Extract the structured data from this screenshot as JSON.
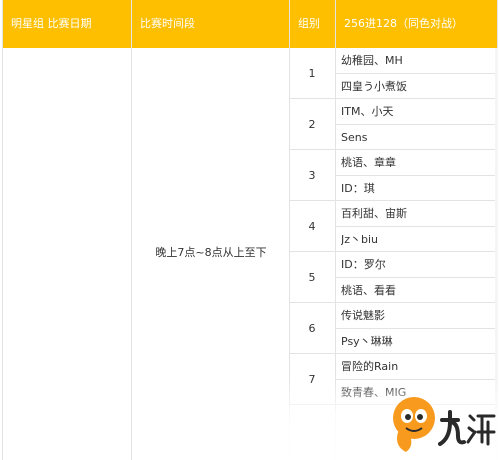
{
  "header": {
    "col1": "明星组 比赛日期",
    "col2": "比赛时间段",
    "col3": "组别",
    "col4": "256进128（同色对战）"
  },
  "time_slot": "晚上7点~8点从上至下",
  "groups": [
    {
      "number": "1",
      "teams": [
        "幼稚园、MH",
        "四皇う小煮饭"
      ]
    },
    {
      "number": "2",
      "teams": [
        "ITM、小天",
        "Sens"
      ]
    },
    {
      "number": "3",
      "teams": [
        "桃语、章章",
        "ID：琪"
      ]
    },
    {
      "number": "4",
      "teams": [
        "百利甜、宙斯",
        "Jz丶biu"
      ]
    },
    {
      "number": "5",
      "teams": [
        "ID：罗尔",
        "桃语、看看"
      ]
    },
    {
      "number": "6",
      "teams": [
        "传说魅影",
        "Psy丶琳琳"
      ]
    },
    {
      "number": "7",
      "teams": [
        "冒险的Rain",
        "致青春、MIG"
      ]
    }
  ],
  "watermark": {
    "brand": "九游",
    "logo_colors": {
      "orange": "#f79a1e",
      "dark": "#2a2a2a"
    }
  }
}
